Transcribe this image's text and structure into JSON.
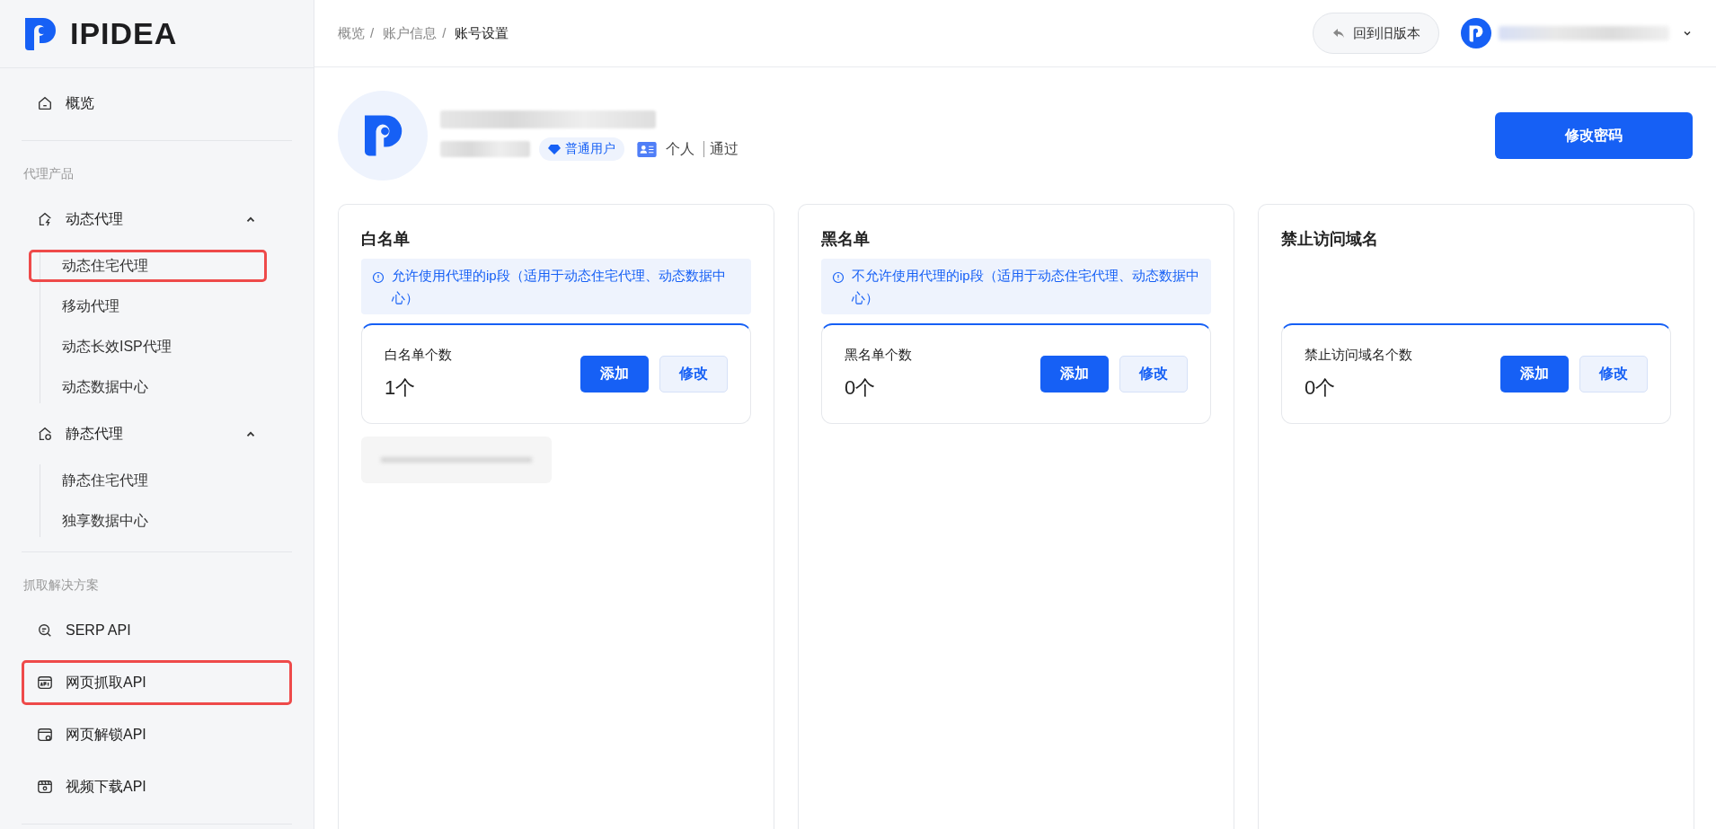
{
  "logo": {
    "text": "IPIDEA"
  },
  "sidebar": {
    "sections": [
      {
        "items": [
          {
            "label": "概览",
            "kind": "home",
            "highlighted": false
          }
        ]
      },
      {
        "title": "代理产品",
        "items": [
          {
            "label": "动态代理",
            "kind": "dynamic",
            "expanded": true,
            "highlighted": false,
            "children": [
              {
                "label": "动态住宅代理",
                "highlighted": true
              },
              {
                "label": "移动代理",
                "highlighted": false
              },
              {
                "label": "动态长效ISP代理",
                "highlighted": false
              },
              {
                "label": "动态数据中心",
                "highlighted": false
              }
            ]
          },
          {
            "label": "静态代理",
            "kind": "static",
            "expanded": true,
            "highlighted": false,
            "children": [
              {
                "label": "静态住宅代理",
                "highlighted": false
              },
              {
                "label": "独享数据中心",
                "highlighted": false
              }
            ]
          }
        ]
      },
      {
        "title": "抓取解决方案",
        "items": [
          {
            "label": "SERP API",
            "kind": "serp",
            "highlighted": false
          },
          {
            "label": "网页抓取API",
            "kind": "api",
            "highlighted": true
          },
          {
            "label": "网页解锁API",
            "kind": "unlock",
            "highlighted": false
          },
          {
            "label": "视频下载API",
            "kind": "video",
            "highlighted": false
          }
        ]
      }
    ]
  },
  "breadcrumb": [
    {
      "label": "概览",
      "separator": "/"
    },
    {
      "label": "账户信息",
      "separator": "/"
    },
    {
      "label": "账号设置"
    }
  ],
  "header": {
    "old_version_button": "回到旧版本"
  },
  "profile": {
    "badge": "普通用户",
    "account_type": "个人",
    "status": "通过",
    "button": "修改密码"
  },
  "cards": [
    {
      "title": "白名单",
      "notice": "允许使用代理的ip段（适用于动态住宅代理、动态数据中心）",
      "count_label": "白名单个数",
      "count": "1个",
      "buttons": [
        "添加",
        "修改"
      ],
      "entries": [
        {
          "kind": "redacted"
        }
      ]
    },
    {
      "title": "黑名单",
      "notice": "不允许使用代理的ip段（适用于动态住宅代理、动态数据中心）",
      "count_label": "黑名单个数",
      "count": "0个",
      "buttons": [
        "添加",
        "修改"
      ]
    },
    {
      "title": "禁止访问域名",
      "count_label": "禁止访问域名个数",
      "count": "0个",
      "buttons": [
        "添加",
        "修改"
      ]
    }
  ]
}
